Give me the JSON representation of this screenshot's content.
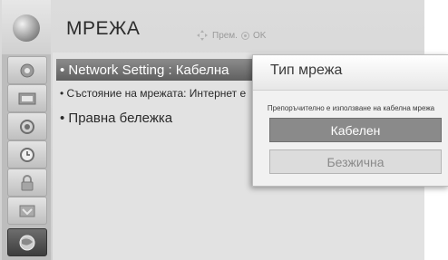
{
  "header": {
    "title": "МРЕЖА",
    "hint_move": "Прем.",
    "hint_ok": "OK"
  },
  "sidebar": {
    "top_icon": "globe-icon",
    "items": [
      {
        "icon": "camera-icon"
      },
      {
        "icon": "picture-icon"
      },
      {
        "icon": "speaker-icon"
      },
      {
        "icon": "clock-icon"
      },
      {
        "icon": "lock-icon"
      },
      {
        "icon": "options-icon"
      },
      {
        "icon": "network-globe-icon",
        "active": true
      }
    ]
  },
  "menu": {
    "items": [
      {
        "label": "• Network Setting   : Кабелна",
        "selected": true
      },
      {
        "label": "• Състояние на мрежата: Интернет е"
      },
      {
        "label": "• Правна бележка"
      }
    ]
  },
  "popup": {
    "title": "Тип мрежа",
    "note": "Препоръчително е използване на кабелна мрежа",
    "options": [
      {
        "label": "Кабелен",
        "selected": true
      },
      {
        "label": "Безжична",
        "selected": false
      }
    ]
  }
}
